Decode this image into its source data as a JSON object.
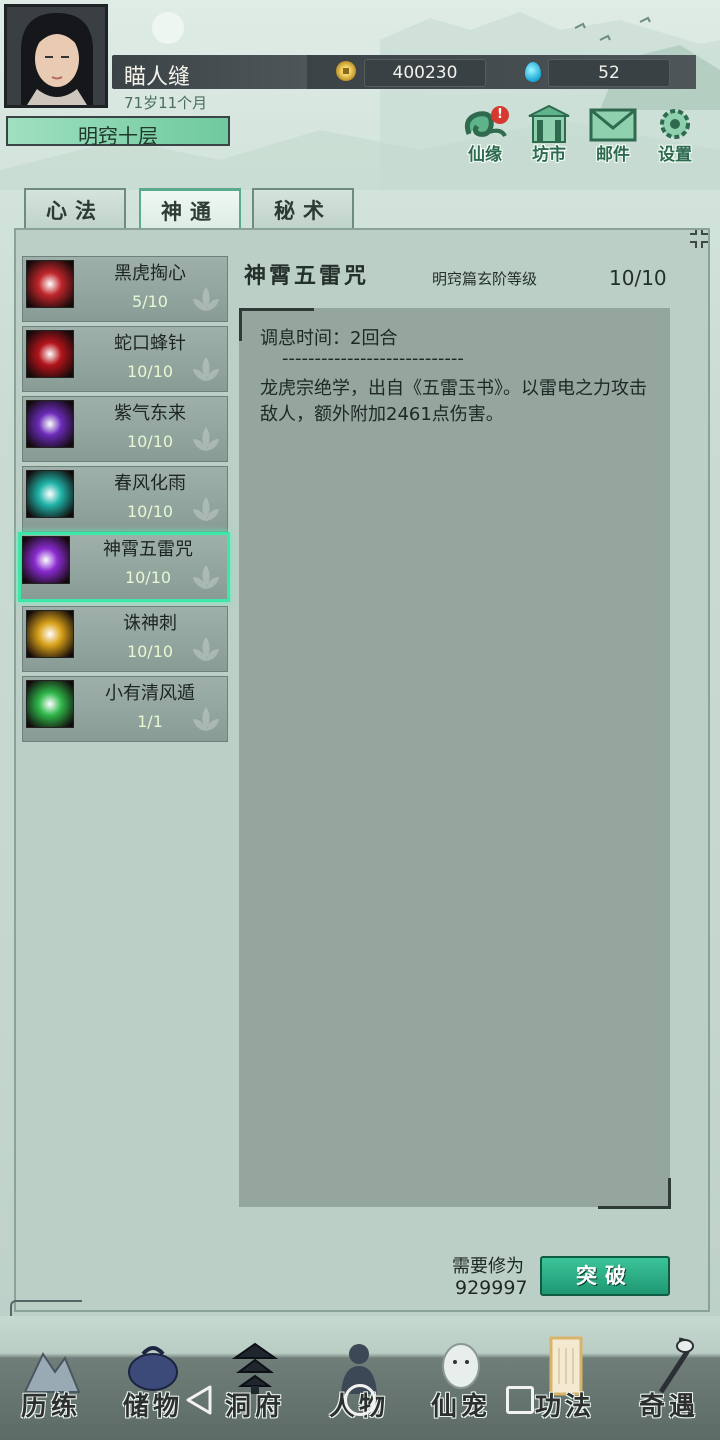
{
  "player": {
    "name": "瞄人缝",
    "age": "71岁11个月",
    "realm": "明窍十层",
    "coins": "400230",
    "gems": "52"
  },
  "top_menu": [
    {
      "label": "仙缘",
      "icon": "xianyuan-icon",
      "badge": "!"
    },
    {
      "label": "坊市",
      "icon": "market-icon"
    },
    {
      "label": "邮件",
      "icon": "mail-icon"
    },
    {
      "label": "设置",
      "icon": "gear-icon"
    }
  ],
  "tabs": [
    "心法",
    "神通",
    "秘术"
  ],
  "active_tab": "神通",
  "skills": [
    {
      "name": "黑虎掏心",
      "level": "5/10",
      "icon": "tiger-claw-icon",
      "color": "#c0262b"
    },
    {
      "name": "蛇口蜂针",
      "level": "10/10",
      "icon": "needle-burst-icon",
      "color": "#b3141b"
    },
    {
      "name": "紫气东来",
      "level": "10/10",
      "icon": "purple-qi-icon",
      "color": "#6a2bb8"
    },
    {
      "name": "春风化雨",
      "level": "10/10",
      "icon": "spring-rain-icon",
      "color": "#1fb3a8"
    },
    {
      "name": "神霄五雷咒",
      "level": "10/10",
      "icon": "lightning-icon",
      "color": "#8a2bd0"
    },
    {
      "name": "诛神刺",
      "level": "10/10",
      "icon": "spear-icon",
      "color": "#d9a21a"
    },
    {
      "name": "小有清风遁",
      "level": "1/1",
      "icon": "wind-escape-icon",
      "color": "#2fb84a"
    }
  ],
  "selected_skill_index": 4,
  "detail": {
    "title": "神霄五雷咒",
    "subtitle": "明窍篇玄阶等级",
    "level": "10/10",
    "cooldown": "调息时间：2回合",
    "separator": "----------------------------",
    "description": "龙虎宗绝学，出自《五雷玉书》。以雷电之力攻击敌人，额外附加2461点伤害。"
  },
  "requirement": {
    "label": "需要修为",
    "value": "929997",
    "button": "突破"
  },
  "bottom_nav": [
    {
      "label": "历练",
      "icon": "mountain-icon"
    },
    {
      "label": "储物",
      "icon": "bag-icon"
    },
    {
      "label": "洞府",
      "icon": "pagoda-icon"
    },
    {
      "label": "人物",
      "icon": "person-icon"
    },
    {
      "label": "仙宠",
      "icon": "pet-icon"
    },
    {
      "label": "功法",
      "icon": "scroll-icon"
    },
    {
      "label": "奇遇",
      "icon": "crane-icon"
    }
  ],
  "colors": {
    "accent": "#3be8a8",
    "button": "#1e9872",
    "panel": "#bccfc7"
  }
}
